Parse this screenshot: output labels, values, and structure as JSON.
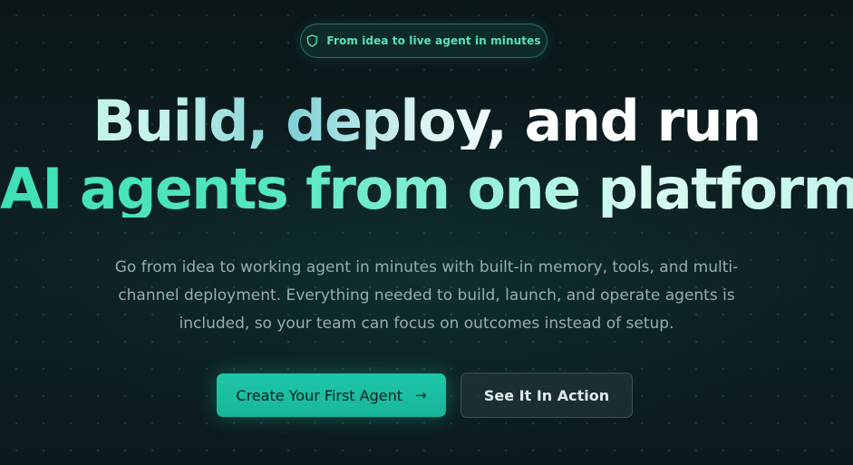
{
  "badge": {
    "icon": "shield-icon",
    "text": "From idea to live agent in minutes"
  },
  "headline": {
    "line1": "Build, deploy, and run",
    "line2": "AI agents from one platform"
  },
  "subtitle": "Go from idea to working agent in minutes with built-in memory, tools, and multi-channel deployment. Everything needed to build, launch, and operate agents is included, so your team can focus on outcomes instead of setup.",
  "cta": {
    "primary_label": "Create Your First Agent",
    "primary_icon": "arrow-right-icon",
    "secondary_label": "See It In Action"
  },
  "colors": {
    "accent": "#1fc7a9",
    "badge_text": "#58e0c0",
    "background": "#0b1a1d"
  }
}
